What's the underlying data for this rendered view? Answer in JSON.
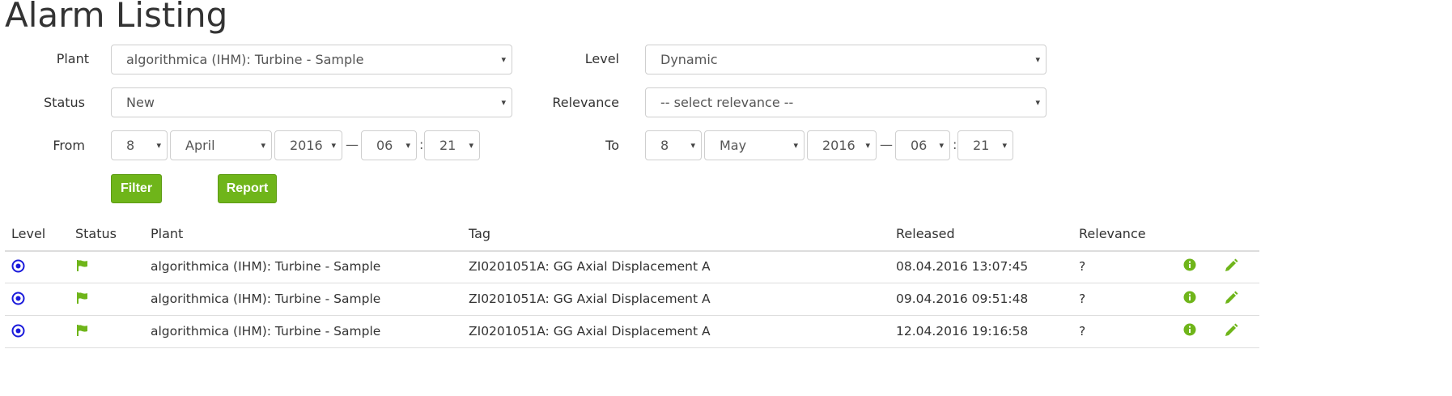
{
  "page": {
    "title": "Alarm Listing"
  },
  "filters": {
    "plant_label": "Plant",
    "plant_value": "algorithmica (IHM): Turbine - Sample",
    "level_label": "Level",
    "level_value": "Dynamic",
    "status_label": "Status",
    "status_value": "New",
    "relevance_label": "Relevance",
    "relevance_value": "-- select relevance --",
    "from_label": "From",
    "from": {
      "day": "8",
      "month": "April",
      "year": "2016",
      "hour": "06",
      "minute": "21"
    },
    "to_label": "To",
    "to": {
      "day": "8",
      "month": "May",
      "year": "2016",
      "hour": "06",
      "minute": "21"
    },
    "dash": "—",
    "colon": ":",
    "caret": "▾"
  },
  "actions": {
    "filter_label": "Filter",
    "report_label": "Report"
  },
  "table": {
    "headers": {
      "level": "Level",
      "status": "Status",
      "plant": "Plant",
      "tag": "Tag",
      "released": "Released",
      "relevance": "Relevance"
    },
    "rows": [
      {
        "plant": "algorithmica (IHM): Turbine - Sample",
        "tag": "ZI0201051A: GG Axial Displacement A",
        "released": "08.04.2016 13:07:45",
        "relevance": "?"
      },
      {
        "plant": "algorithmica (IHM): Turbine - Sample",
        "tag": "ZI0201051A: GG Axial Displacement A",
        "released": "09.04.2016 09:51:48",
        "relevance": "?"
      },
      {
        "plant": "algorithmica (IHM): Turbine - Sample",
        "tag": "ZI0201051A: GG Axial Displacement A",
        "released": "12.04.2016 19:16:58",
        "relevance": "?"
      }
    ]
  },
  "colors": {
    "accent": "#6fb51a",
    "level_icon": "#1a1adb"
  },
  "icons": {
    "level": "target-icon",
    "status": "flag-icon",
    "info": "info-icon",
    "edit": "pencil-icon"
  }
}
